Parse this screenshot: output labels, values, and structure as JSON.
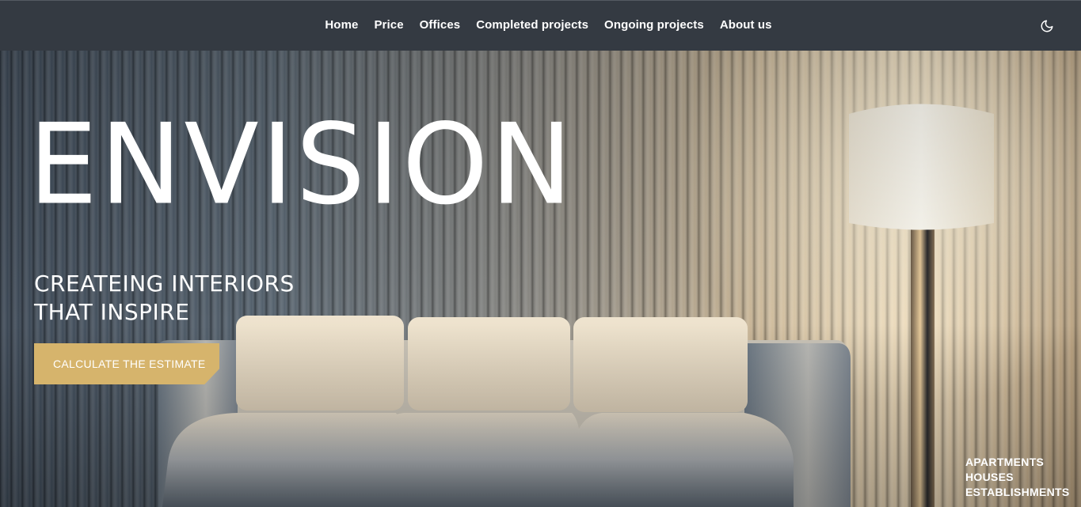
{
  "nav": {
    "items": [
      {
        "label": "Home"
      },
      {
        "label": "Price"
      },
      {
        "label": "Offices"
      },
      {
        "label": "Completed projects"
      },
      {
        "label": "Ongoing projects"
      },
      {
        "label": "About us"
      }
    ],
    "theme_toggle_icon": "moon-icon"
  },
  "hero": {
    "title": "ENVISION",
    "tagline_line1": "CREATEING INTERIORS",
    "tagline_line2": "THAT INSPIRE",
    "cta_label": "CALCULATE THE ESTIMATE",
    "cta_color": "#d6b46c",
    "categories": [
      {
        "label": "APARTMENTS"
      },
      {
        "label": "HOUSES"
      },
      {
        "label": "ESTABLISHMENTS"
      }
    ]
  },
  "colors": {
    "nav_bg": "#343a42",
    "text": "#ffffff"
  }
}
